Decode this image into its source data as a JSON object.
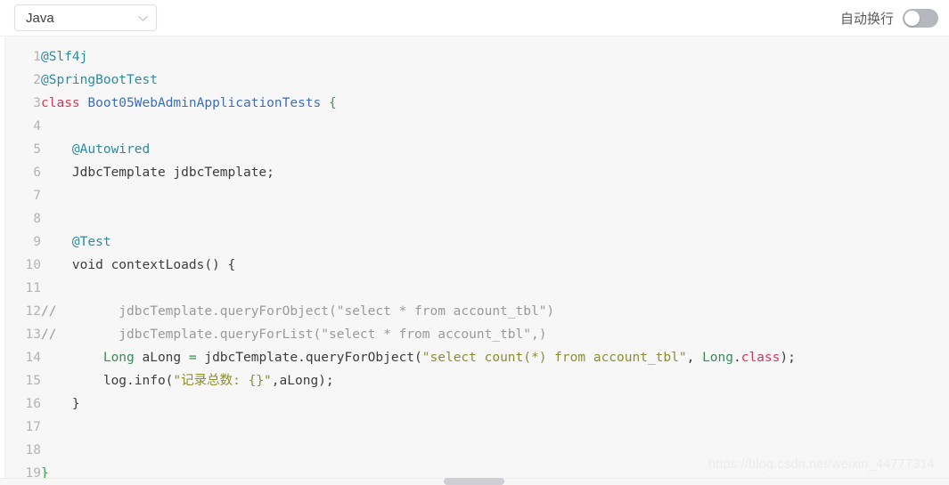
{
  "toolbar": {
    "language_select": {
      "value": "Java",
      "icon": "chevron-down-icon"
    },
    "word_wrap": {
      "label": "自动换行",
      "state": "off"
    }
  },
  "editor": {
    "language": "Java",
    "total_lines": 19,
    "lines": [
      {
        "number": "1",
        "text": "@Slf4j",
        "tokens": [
          {
            "text": "@Slf4j",
            "type": "annotation"
          }
        ]
      },
      {
        "number": "2",
        "text": "@SpringBootTest",
        "tokens": [
          {
            "text": "@SpringBootTest",
            "type": "annotation"
          }
        ]
      },
      {
        "number": "3",
        "text": "class Boot05WebAdminApplicationTests {",
        "tokens": [
          {
            "text": "class",
            "type": "keyword"
          },
          {
            "text": " ",
            "type": "plain"
          },
          {
            "text": "Boot05WebAdminApplicationTests",
            "type": "class"
          },
          {
            "text": " ",
            "type": "plain"
          },
          {
            "text": "{",
            "type": "brace"
          }
        ]
      },
      {
        "number": "4",
        "text": "",
        "tokens": []
      },
      {
        "number": "5",
        "text": "    @Autowired",
        "tokens": [
          {
            "text": "    ",
            "type": "plain"
          },
          {
            "text": "@Autowired",
            "type": "annotation"
          }
        ]
      },
      {
        "number": "6",
        "text": "    JdbcTemplate jdbcTemplate;",
        "tokens": [
          {
            "text": "    JdbcTemplate jdbcTemplate;",
            "type": "plain"
          }
        ]
      },
      {
        "number": "7",
        "text": "",
        "tokens": []
      },
      {
        "number": "8",
        "text": "",
        "tokens": []
      },
      {
        "number": "9",
        "text": "    @Test",
        "tokens": [
          {
            "text": "    ",
            "type": "plain"
          },
          {
            "text": "@Test",
            "type": "annotation"
          }
        ]
      },
      {
        "number": "10",
        "text": "    void contextLoads() {",
        "tokens": [
          {
            "text": "    void contextLoads() {",
            "type": "plain"
          }
        ]
      },
      {
        "number": "11",
        "text": "",
        "tokens": []
      },
      {
        "number": "12",
        "text": "//        jdbcTemplate.queryForObject(\"select * from account_tbl\")",
        "tokens": [
          {
            "text": "//        jdbcTemplate.queryForObject(\"select * from account_tbl\")",
            "type": "comment"
          }
        ]
      },
      {
        "number": "13",
        "text": "//        jdbcTemplate.queryForList(\"select * from account_tbl\",)",
        "tokens": [
          {
            "text": "//        jdbcTemplate.queryForList(\"select * from account_tbl\",)",
            "type": "comment"
          }
        ]
      },
      {
        "number": "14",
        "text": "        Long aLong = jdbcTemplate.queryForObject(\"select count(*) from account_tbl\", Long.class);",
        "tokens": [
          {
            "text": "        ",
            "type": "plain"
          },
          {
            "text": "Long",
            "type": "type"
          },
          {
            "text": " aLong ",
            "type": "plain"
          },
          {
            "text": "=",
            "type": "operator"
          },
          {
            "text": " jdbcTemplate.queryForObject(",
            "type": "plain"
          },
          {
            "text": "\"select count(*) from account_tbl\"",
            "type": "string"
          },
          {
            "text": ", ",
            "type": "plain"
          },
          {
            "text": "Long",
            "type": "type"
          },
          {
            "text": ".",
            "type": "plain"
          },
          {
            "text": "class",
            "type": "keyword"
          },
          {
            "text": ");",
            "type": "plain"
          }
        ]
      },
      {
        "number": "15",
        "text": "        log.info(\"记录总数: {}\",aLong);",
        "tokens": [
          {
            "text": "        log.info(",
            "type": "plain"
          },
          {
            "text": "\"记录总数: {}\"",
            "type": "string"
          },
          {
            "text": ",aLong);",
            "type": "plain"
          }
        ]
      },
      {
        "number": "16",
        "text": "    }",
        "tokens": [
          {
            "text": "    }",
            "type": "plain"
          }
        ]
      },
      {
        "number": "17",
        "text": "",
        "tokens": []
      },
      {
        "number": "18",
        "text": "",
        "tokens": []
      },
      {
        "number": "19",
        "text": "}",
        "tokens": [
          {
            "text": "}",
            "type": "brace"
          }
        ]
      }
    ]
  },
  "watermark": {
    "text": "https://blog.csdn.net/weixin_44777314"
  },
  "colors": {
    "annotation": "#2e8b9c",
    "keyword": "#d0385c",
    "type": "#3b8b58",
    "class": "#3d6fb5",
    "brace": "#3b9d4f",
    "string": "#8a8f2e",
    "comment": "#9a9a9a",
    "plain": "#3d3d3d",
    "editor_background": "#f7f7f8",
    "gutter_text": "#b3b3b3"
  }
}
